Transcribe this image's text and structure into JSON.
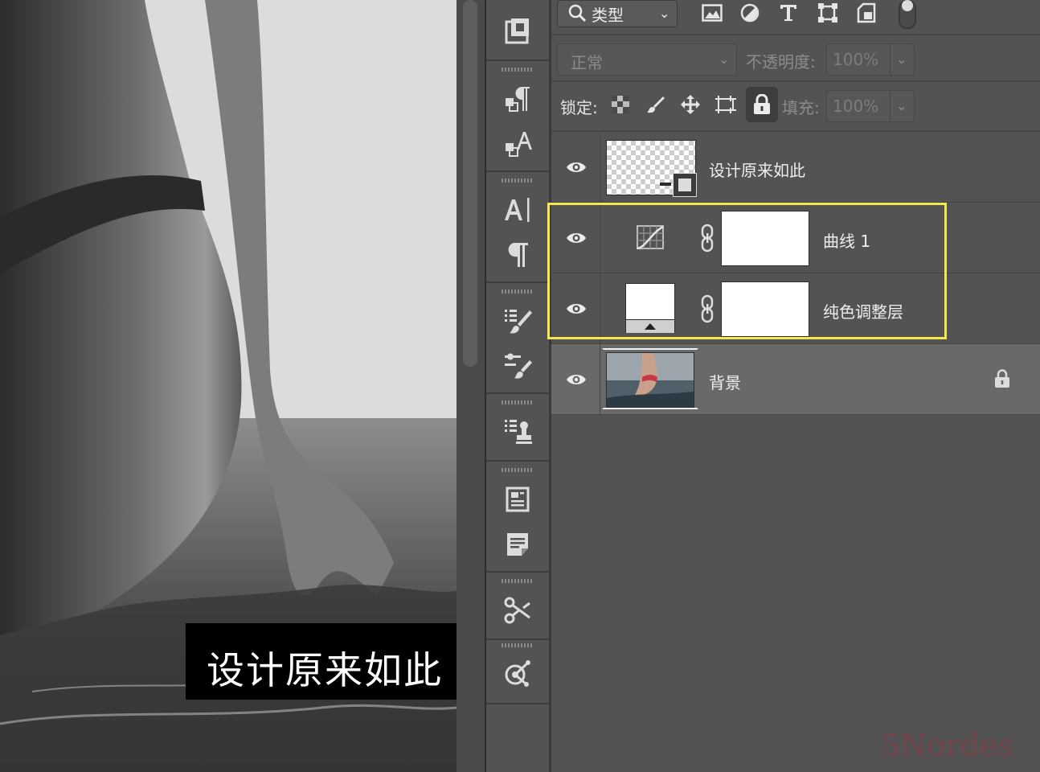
{
  "canvas": {
    "overlay_text": "设计原来如此"
  },
  "layers_panel": {
    "filter": {
      "kind_label": "类型"
    },
    "blend_mode": {
      "value": "正常"
    },
    "opacity": {
      "label": "不透明度:",
      "value": "100%"
    },
    "lock": {
      "label": "锁定:"
    },
    "fill": {
      "label": "填充:",
      "value": "100%"
    },
    "layers": [
      {
        "name": "设计原来如此",
        "type": "smart-object",
        "visible": true
      },
      {
        "name": "曲线 1",
        "type": "curves-adjustment",
        "visible": true,
        "has_mask": true
      },
      {
        "name": "纯色调整层",
        "type": "solid-color-fill",
        "visible": true,
        "has_mask": true
      },
      {
        "name": "背景",
        "type": "background",
        "visible": true,
        "locked": true,
        "selected": true
      }
    ]
  },
  "highlight": {
    "color": "#f4e74f"
  },
  "watermark": "5Nordes"
}
